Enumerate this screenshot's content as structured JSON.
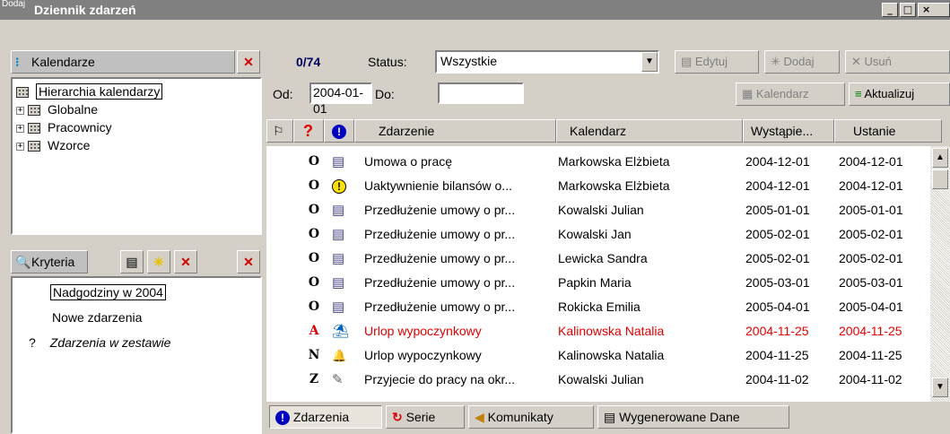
{
  "window": {
    "corner_label": "Dodaj",
    "title": "Dziennik zdarzeń",
    "buttons": [
      "_",
      "□",
      "×"
    ]
  },
  "calendars": {
    "header": "Kalendarze",
    "root": "Hierarchia kalendarzy",
    "items": [
      "Globalne",
      "Pracownicy",
      "Wzorce"
    ]
  },
  "criteria": {
    "header": "Kryteria",
    "items": [
      "Nadgodziny w 2004",
      "Nowe zdarzenia",
      "Zdarzenia w zestawie"
    ],
    "third_marker": "?"
  },
  "toolbar": {
    "count": "0/74",
    "status_label": "Status:",
    "status_value": "Wszystkie",
    "edit": "Edytuj",
    "add": "Dodaj",
    "delete": "Usuń",
    "from_label": "Od:",
    "from_value": "2004-01-01",
    "to_label": "Do:",
    "to_value": "",
    "calendar_btn": "Kalendarz",
    "refresh_btn": "Aktualizuj"
  },
  "table": {
    "columns": [
      "Zdarzenie",
      "Kalendarz",
      "Wystąpie...",
      "Ustanie"
    ],
    "rows": [
      {
        "mark": "O",
        "icon": "document-icon",
        "event": "Umowa o pracę",
        "calendar": "Markowska Elżbieta",
        "occur": "2004-12-01",
        "end": "2004-12-01",
        "red": false
      },
      {
        "mark": "O",
        "icon": "warning-icon",
        "event": "Uaktywnienie bilansów o...",
        "calendar": "Markowska Elżbieta",
        "occur": "2004-12-01",
        "end": "2004-12-01",
        "red": false
      },
      {
        "mark": "O",
        "icon": "document-icon",
        "event": "Przedłużenie umowy o pr...",
        "calendar": "Kowalski Julian",
        "occur": "2005-01-01",
        "end": "2005-01-01",
        "red": false
      },
      {
        "mark": "O",
        "icon": "document-icon",
        "event": "Przedłużenie umowy o pr...",
        "calendar": "Kowalski Jan",
        "occur": "2005-02-01",
        "end": "2005-02-01",
        "red": false
      },
      {
        "mark": "O",
        "icon": "document-icon",
        "event": "Przedłużenie umowy o pr...",
        "calendar": "Lewicka Sandra",
        "occur": "2005-02-01",
        "end": "2005-02-01",
        "red": false
      },
      {
        "mark": "O",
        "icon": "document-icon",
        "event": "Przedłużenie umowy o pr...",
        "calendar": "Papkin Maria",
        "occur": "2005-03-01",
        "end": "2005-03-01",
        "red": false
      },
      {
        "mark": "O",
        "icon": "document-icon",
        "event": "Przedłużenie umowy o pr...",
        "calendar": "Rokicka Emilia",
        "occur": "2005-04-01",
        "end": "2005-04-01",
        "red": false
      },
      {
        "mark": "A",
        "icon": "vacation-icon",
        "event": "Urlop wypoczynkowy",
        "calendar": "Kalinowska Natalia",
        "occur": "2004-11-25",
        "end": "2004-11-25",
        "red": true
      },
      {
        "mark": "N",
        "icon": "bell-icon",
        "event": "Urlop wypoczynkowy",
        "calendar": "Kalinowska Natalia",
        "occur": "2004-11-25",
        "end": "2004-11-25",
        "red": false
      },
      {
        "mark": "Z",
        "icon": "hire-icon",
        "event": "Przyjecie do pracy na okr...",
        "calendar": "Kowalski Julian",
        "occur": "2004-11-02",
        "end": "2004-11-02",
        "red": false
      }
    ]
  },
  "tabs": [
    "Zdarzenia",
    "Serie",
    "Komunikaty",
    "Wygenerowane Dane"
  ]
}
